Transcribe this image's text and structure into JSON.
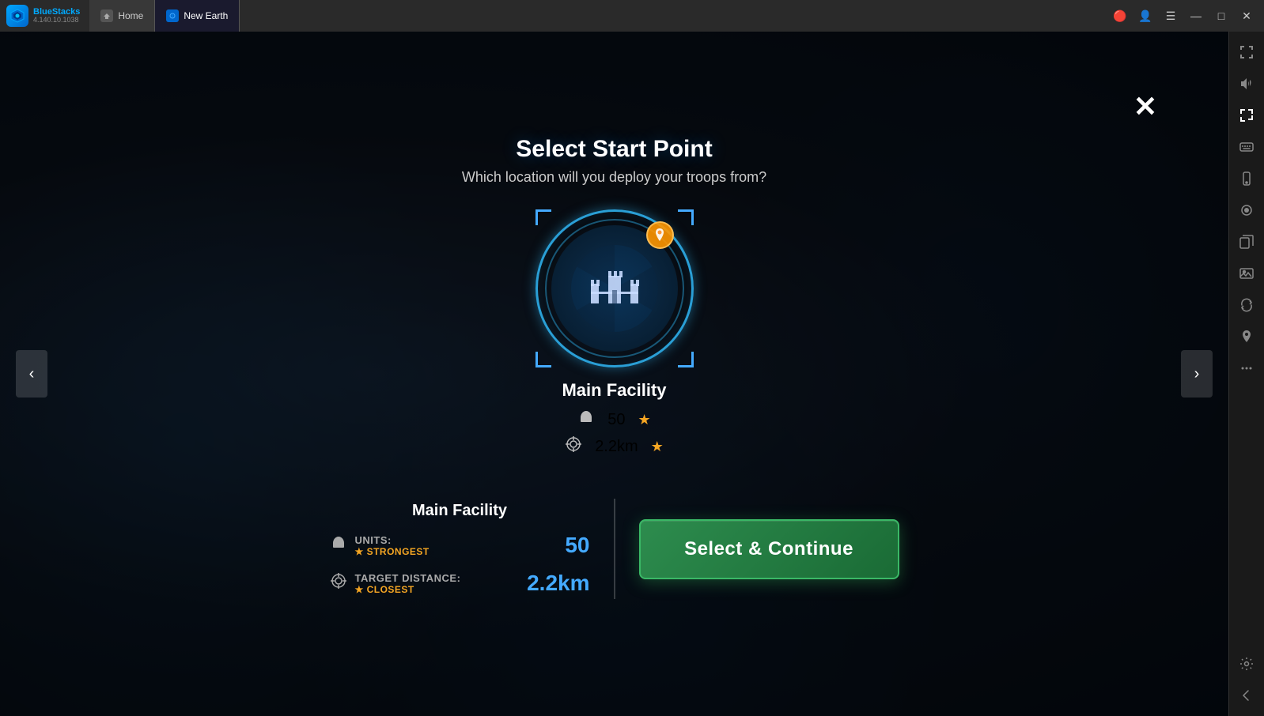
{
  "app": {
    "name": "BlueStacks",
    "version": "4.140.10.1038"
  },
  "tabs": [
    {
      "id": "home",
      "label": "Home",
      "active": false
    },
    {
      "id": "new-earth",
      "label": "New Earth",
      "active": true
    }
  ],
  "window_controls": {
    "notification_icon": "🔴",
    "profile_icon": "👤",
    "menu_icon": "☰",
    "minimize": "—",
    "maximize": "□",
    "close": "✕"
  },
  "sidebar_buttons": [
    {
      "id": "fullscreen",
      "icon": "⛶",
      "label": "fullscreen-icon"
    },
    {
      "id": "volume",
      "icon": "🔊",
      "label": "volume-icon"
    },
    {
      "id": "expand",
      "icon": "⤢",
      "label": "expand-icon"
    },
    {
      "id": "keyboard",
      "icon": "⌨",
      "label": "keyboard-icon"
    },
    {
      "id": "mobile",
      "icon": "📱",
      "label": "mobile-icon"
    },
    {
      "id": "record",
      "icon": "⏺",
      "label": "record-icon"
    },
    {
      "id": "copy",
      "icon": "📋",
      "label": "copy-icon"
    },
    {
      "id": "gallery",
      "icon": "🖼",
      "label": "gallery-icon"
    },
    {
      "id": "replay",
      "icon": "↩",
      "label": "replay-icon"
    },
    {
      "id": "location",
      "icon": "📍",
      "label": "location-icon"
    },
    {
      "id": "more",
      "icon": "⋯",
      "label": "more-icon"
    },
    {
      "id": "settings",
      "icon": "⚙",
      "label": "settings-icon"
    },
    {
      "id": "back",
      "icon": "←",
      "label": "back-icon"
    }
  ],
  "modal": {
    "title": "Select Start Point",
    "subtitle": "Which location will you deploy your troops from?",
    "close_label": "✕",
    "nav_left": "‹",
    "nav_right": "›",
    "facility": {
      "name": "Main Facility",
      "units": 50,
      "units_label": "UNITS:",
      "units_badge": "STRONGEST",
      "distance": "2.2km",
      "distance_label": "TARGET DISTANCE:",
      "distance_badge": "CLOSEST"
    },
    "select_button_label": "Select & Continue"
  }
}
